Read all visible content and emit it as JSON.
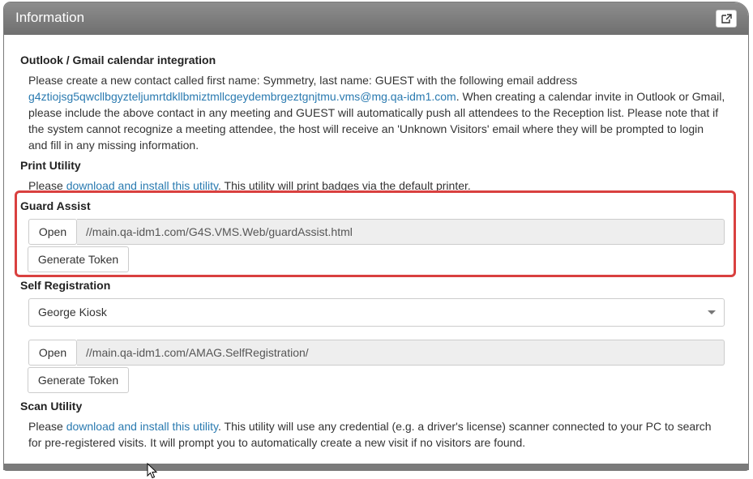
{
  "header": {
    "title": "Information",
    "popout_icon": "external-link-icon"
  },
  "outlook": {
    "heading": "Outlook / Gmail calendar integration",
    "line1": "Please create a new contact called first name: Symmetry, last name: GUEST with the following email address",
    "email": "g4ztiojsg5qwcllbgyzteljumrtdkllbmiztmllcgeydembrgeztgnjtmu.vms@mg.qa-idm1.com",
    "line2_after_email": ". When creating a calendar invite in Outlook or Gmail,",
    "line3": "please include the above contact in any meeting and GUEST will automatically push all attendees to the Reception list. Please note that if",
    "line4": "the system cannot recognize a meeting attendee, the host will receive an 'Unknown Visitors' email where they will be prompted to login",
    "line5": "and fill in any missing information."
  },
  "print_utility": {
    "heading": "Print Utility",
    "prefix": "Please ",
    "link": "download and install this utility",
    "suffix": ". This utility will print badges via the default printer."
  },
  "guard_assist": {
    "heading": "Guard Assist",
    "open_label": "Open",
    "url": "//main.qa-idm1.com/G4S.VMS.Web/guardAssist.html",
    "generate_label": "Generate Token"
  },
  "self_registration": {
    "heading": "Self Registration",
    "selected_kiosk": "George Kiosk",
    "open_label": "Open",
    "url": "//main.qa-idm1.com/AMAG.SelfRegistration/",
    "generate_label": "Generate Token"
  },
  "scan_utility": {
    "heading": "Scan Utility",
    "prefix": "Please ",
    "link": "download and install this utility",
    "suffix": ". This utility will use any credential (e.g. a driver's license) scanner connected to your PC to search",
    "line2": "for pre-registered visits. It will prompt you to automatically create a new visit if no visitors are found."
  },
  "colors": {
    "header": "#7a7a7a",
    "link": "#2a7ab0",
    "highlight": "#d9403f",
    "addon_bg": "#eeeeee"
  }
}
